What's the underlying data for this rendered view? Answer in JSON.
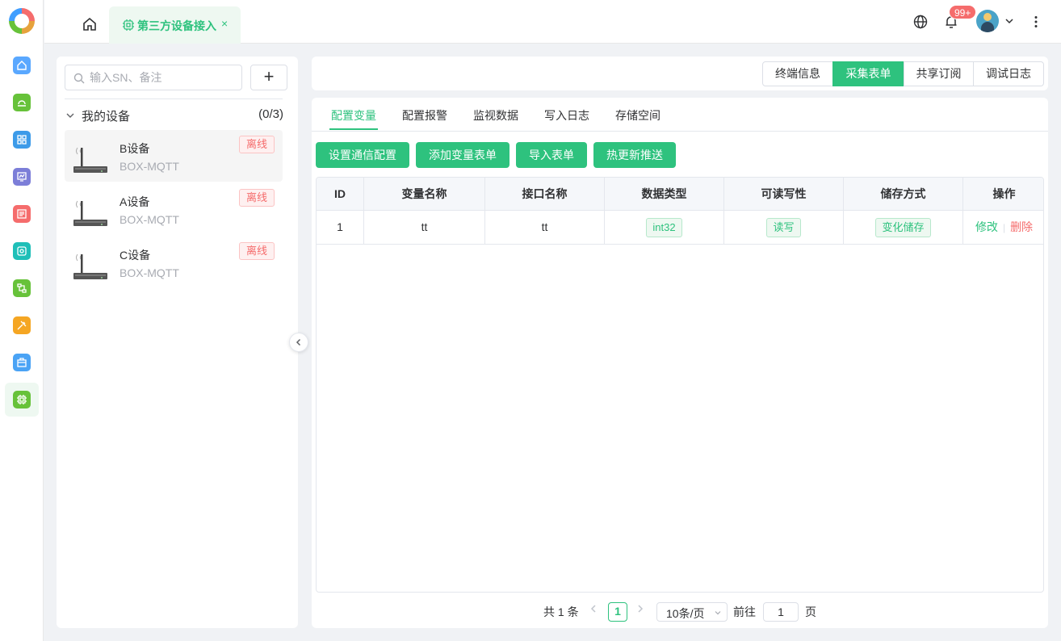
{
  "topbar": {
    "active_tab": "第三方设备接入",
    "tab_close": "×",
    "badge": "99+"
  },
  "left": {
    "search_placeholder": "输入SN、备注",
    "add_label": "+",
    "group": {
      "title": "我的设备",
      "count": "(0/3)"
    },
    "devices": [
      {
        "name": "B设备",
        "type": "BOX-MQTT",
        "status": "离线"
      },
      {
        "name": "A设备",
        "type": "BOX-MQTT",
        "status": "离线"
      },
      {
        "name": "C设备",
        "type": "BOX-MQTT",
        "status": "离线"
      }
    ]
  },
  "segments": [
    "终端信息",
    "采集表单",
    "共享订阅",
    "调试日志"
  ],
  "subtabs": [
    "配置变量",
    "配置报警",
    "监视数据",
    "写入日志",
    "存储空间"
  ],
  "actions": [
    "设置通信配置",
    "添加变量表单",
    "导入表单",
    "热更新推送"
  ],
  "table": {
    "headers": [
      "ID",
      "变量名称",
      "接口名称",
      "数据类型",
      "可读写性",
      "储存方式",
      "操作"
    ],
    "rows": [
      {
        "id": "1",
        "var_name": "tt",
        "iface": "tt",
        "dtype": "int32",
        "rw": "读写",
        "storage": "变化储存",
        "edit": "修改",
        "del": "删除"
      }
    ]
  },
  "pager": {
    "total": "共 1 条",
    "current": "1",
    "size": "10条/页",
    "goto": "前往",
    "goto_value": "1",
    "page_suffix": "页"
  },
  "colors": {
    "accent": "#2ec27e",
    "danger": "#f56c6c"
  }
}
